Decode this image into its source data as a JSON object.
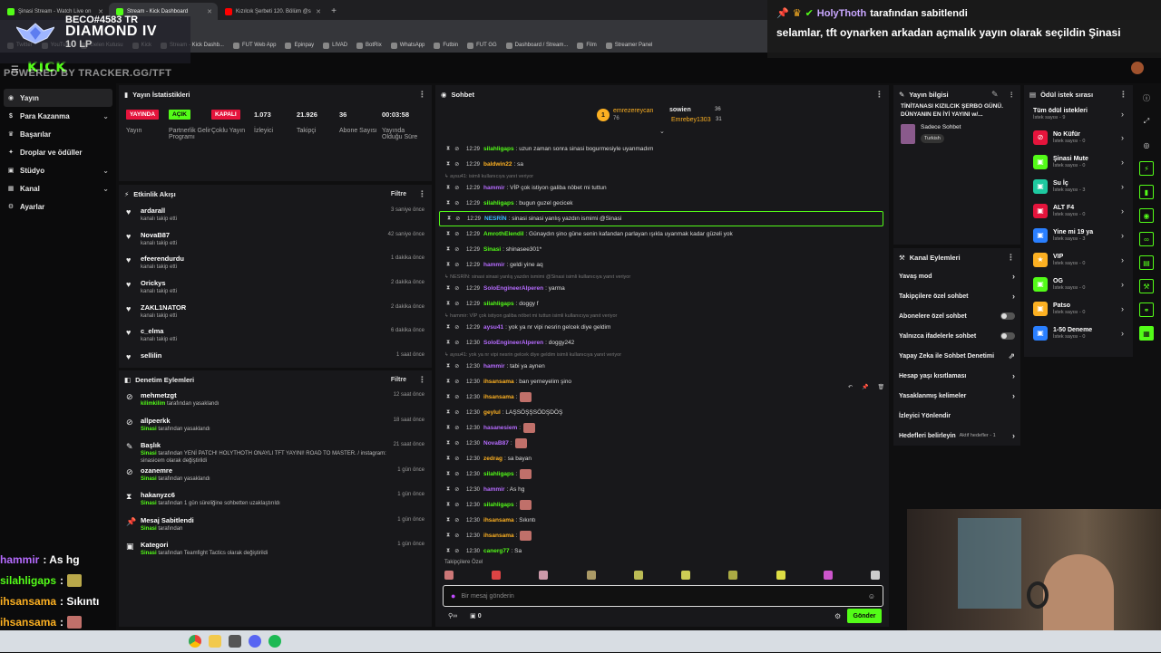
{
  "browser": {
    "tabs": [
      {
        "label": "Şinasi Stream - Watch Live on",
        "color": "#53fc18",
        "active": false
      },
      {
        "label": "Stream - Kick Dashboard",
        "color": "#53fc18",
        "active": true
      },
      {
        "label": "Kızılcık Şerbeti 120. Bölüm @s",
        "color": "#ff0000",
        "active": false
      }
    ],
    "new_tab": "+",
    "bookmarks": [
      "Twitter",
      "YouTube",
      "Gelen Kutusu",
      "Kick",
      "Stream - Kick Dashb...",
      "FUT Web App",
      "Epinpay",
      "LIVAD",
      "BotRix",
      "WhatsApp",
      "Futbin",
      "FUT GG",
      "Dashboard / Stream...",
      "Film",
      "Streamer Panel"
    ]
  },
  "overlay": {
    "rank_tag": "BECO#4583 TR",
    "rank_name": "DIAMOND IV",
    "rank_lp": "10 LP",
    "powered_by": "POWERED BY TRACKER.GG/TFT",
    "pinned_by_user": "HolyThoth",
    "pinned_by_text": "tarafından sabitlendi",
    "pinned_message": "selamlar, tft oynarken arkadan açmalık yayın olarak seçildin Şinasi"
  },
  "kick": {
    "logo": "KICK"
  },
  "sidebar": {
    "items": [
      {
        "label": "Yayın",
        "icon": "broadcast-icon"
      },
      {
        "label": "Para Kazanma",
        "icon": "money-icon"
      },
      {
        "label": "Başarılar",
        "icon": "trophy-icon"
      },
      {
        "label": "Droplar ve ödüller",
        "icon": "gift-icon"
      },
      {
        "label": "Stüdyo",
        "icon": "studio-icon"
      },
      {
        "label": "Kanal",
        "icon": "channel-icon"
      },
      {
        "label": "Ayarlar",
        "icon": "gear-icon"
      }
    ]
  },
  "stream_stats": {
    "title": "Yayın İstatistikleri",
    "items": [
      {
        "value": "YAYINDA",
        "label": "Yayın",
        "pill": "red"
      },
      {
        "value": "AÇIK",
        "label": "Partnerlik Gelir Programı",
        "pill": "green"
      },
      {
        "value": "KAPALI",
        "label": "Çoklu Yayın",
        "pill": "red"
      },
      {
        "value": "1.073",
        "label": "İzleyici",
        "pill": ""
      },
      {
        "value": "21.926",
        "label": "Takipçi",
        "pill": ""
      },
      {
        "value": "36",
        "label": "Abone Sayısı",
        "pill": ""
      },
      {
        "value": "00:03:58",
        "label": "Yayında Olduğu Süre",
        "pill": ""
      }
    ]
  },
  "activity": {
    "title": "Etkinlik Akışı",
    "filter": "Filtre",
    "items": [
      {
        "name": "ardarall",
        "sub": "kanalı takip etti",
        "time": "3 saniye önce"
      },
      {
        "name": "NovaB87",
        "sub": "kanalı takip etti",
        "time": "42 saniye önce"
      },
      {
        "name": "efeerendurdu",
        "sub": "kanalı takip etti",
        "time": "1 dakika önce"
      },
      {
        "name": "Orickys",
        "sub": "kanalı takip etti",
        "time": "2 dakika önce"
      },
      {
        "name": "ZAKL1NATOR",
        "sub": "kanalı takip etti",
        "time": "2 dakika önce"
      },
      {
        "name": "c_elma",
        "sub": "kanalı takip etti",
        "time": "6 dakika önce"
      },
      {
        "name": "sellilin",
        "sub": "",
        "time": "1 saat önce"
      }
    ]
  },
  "moderation": {
    "title": "Denetim Eylemleri",
    "filter": "Filtre",
    "items": [
      {
        "name": "mehmetzgt",
        "actor": "kilimkilim",
        "rest": "tarafından yasaklandı",
        "time": "12 saat önce",
        "icon": "ban-icon"
      },
      {
        "name": "allpeerkk",
        "actor": "Sinasi",
        "rest": "tarafından yasaklandı",
        "time": "18 saat önce",
        "icon": "ban-icon"
      },
      {
        "name": "Başlık",
        "actor": "Sinasi",
        "rest": "tarafından YENİ PATCH! HOLYTHOTH ONAYLI TFT YAYINI! ROAD TO MASTER. / instagram: sinasicem olarak değiştirildi",
        "time": "21 saat önce",
        "icon": "pencil-icon"
      },
      {
        "name": "ozanemre",
        "actor": "Sinasi",
        "rest": "tarafından yasaklandı",
        "time": "1 gün önce",
        "icon": "ban-icon"
      },
      {
        "name": "hakanyzc6",
        "actor": "Sinasi",
        "rest": "tarafından 1 gün süreliğine sohbetten uzaklaştırıldı",
        "time": "1 gün önce",
        "icon": "hourglass-icon"
      },
      {
        "name": "Mesaj Sabitlendi",
        "actor": "Sinasi",
        "rest": "tarafından",
        "time": "1 gün önce",
        "icon": "pin-icon"
      },
      {
        "name": "Kategori",
        "actor": "Sinasi",
        "rest": "tarafından Teamfight Tactics olarak değiştirildi",
        "time": "1 gün önce",
        "icon": "category-icon"
      }
    ]
  },
  "chat": {
    "title": "Sohbet",
    "top_users": [
      {
        "name": "emrezereycan",
        "count": "76",
        "rank": "1"
      },
      {
        "name": "sowien",
        "count": "36"
      },
      {
        "name": "Emrebey1303",
        "count": "31"
      }
    ],
    "messages": [
      {
        "type": "msg",
        "time": "12:29",
        "user": "silahligaps",
        "color": "#53fc18",
        "text": ": uzun zaman sonra sinasi bogurmesiyle uyanmadım"
      },
      {
        "type": "msg",
        "time": "12:29",
        "user": "baldwin22",
        "color": "#fcb022",
        "text": ": sa"
      },
      {
        "type": "reply",
        "text": "aysu41: isimli kullanıcıya yanıt veriyor"
      },
      {
        "type": "msg",
        "time": "12:29",
        "user": "hammir",
        "color": "#b66bff",
        "text": ": VİP çok istiyon galiba nöbet mi tuttun"
      },
      {
        "type": "msg",
        "time": "12:29",
        "user": "silahligaps",
        "color": "#53fc18",
        "text": ": bugun guzel gecicek"
      },
      {
        "type": "msg",
        "time": "12:29",
        "user": "NESRİN",
        "color": "#3db8ff",
        "text": ": sinasi sinasi yanlış yazdın ismimi @Sinasi",
        "highlight": true
      },
      {
        "type": "msg",
        "time": "12:29",
        "user": "AmrothElendil",
        "color": "#53fc18",
        "text": ": Günaydın şino güne senin kafandan parlayan ışıkla uyanmak kadar güzeli yok"
      },
      {
        "type": "msg",
        "time": "12:29",
        "user": "Sinasi",
        "color": "#53fc18",
        "text": ": shinasee301*"
      },
      {
        "type": "msg",
        "time": "12:29",
        "user": "hammir",
        "color": "#b66bff",
        "text": ": geldi yine aq"
      },
      {
        "type": "reply",
        "text": "NESRİN: sinasi sinasi yanlış yazdın ismimi @Sinasi isimli kullanıcıya yanıt veriyor"
      },
      {
        "type": "msg",
        "time": "12:29",
        "user": "SoloEngineerAlperen",
        "color": "#b66bff",
        "text": ": yarma"
      },
      {
        "type": "msg",
        "time": "12:29",
        "user": "silahligaps",
        "color": "#53fc18",
        "text": ": doggy f"
      },
      {
        "type": "reply",
        "text": "hammir: VİP çok istiyon galiba nöbet mi tuttun isimli kullanıcıya yanıt veriyor"
      },
      {
        "type": "msg",
        "time": "12:29",
        "user": "aysu41",
        "color": "#b66bff",
        "text": ": yok ya nr vipi nesrin gelcek diye geldim"
      },
      {
        "type": "msg",
        "time": "12:30",
        "user": "SoloEngineerAlperen",
        "color": "#b66bff",
        "text": ": doggy242"
      },
      {
        "type": "reply",
        "text": "aysu41: yok ya nr vipi nesrin gelcek diye geldim isimli kullanıcıya yanıt veriyor"
      },
      {
        "type": "msg",
        "time": "12:30",
        "user": "hammir",
        "color": "#b66bff",
        "text": ": tabi ya aynen"
      },
      {
        "type": "msg",
        "time": "12:30",
        "user": "ihsansama",
        "color": "#fcb022",
        "text": ": ban yerneyelim şino"
      },
      {
        "type": "msg",
        "time": "12:30",
        "user": "ihsansama",
        "color": "#fcb022",
        "text": ":",
        "emote": true
      },
      {
        "type": "msg",
        "time": "12:30",
        "user": "geylul",
        "color": "#fcb022",
        "text": ": LAŞSÖŞŞSÖDŞDÖŞ"
      },
      {
        "type": "msg",
        "time": "12:30",
        "user": "hasanesiem",
        "color": "#b66bff",
        "text": ":",
        "emote": true
      },
      {
        "type": "msg",
        "time": "12:30",
        "user": "NovaB87",
        "color": "#b66bff",
        "text": ":",
        "emote": true
      },
      {
        "type": "msg",
        "time": "12:30",
        "user": "zedrag",
        "color": "#fcb022",
        "text": ": sa bayan"
      },
      {
        "type": "msg",
        "time": "12:30",
        "user": "silahligaps",
        "color": "#53fc18",
        "text": ":",
        "emote": true
      },
      {
        "type": "msg",
        "time": "12:30",
        "user": "hammir",
        "color": "#b66bff",
        "text": ": As hg"
      },
      {
        "type": "msg",
        "time": "12:30",
        "user": "silahligaps",
        "color": "#53fc18",
        "text": ":",
        "emote": true
      },
      {
        "type": "msg",
        "time": "12:30",
        "user": "ihsansama",
        "color": "#fcb022",
        "text": ": Sıkıntı"
      },
      {
        "type": "msg",
        "time": "12:30",
        "user": "ihsansama",
        "color": "#fcb022",
        "text": ":",
        "emote": true
      },
      {
        "type": "msg",
        "time": "12:30",
        "user": "canerg77",
        "color": "#53fc18",
        "text": ": Sa"
      }
    ],
    "followers_only_label": "Takipçilere Özel",
    "input_placeholder": "Bir mesaj gönderin",
    "points": "0",
    "send_label": "Gönder"
  },
  "stream_info": {
    "title": "Yayın bilgisi",
    "stream_title": "TİNİTANASI KIZILCIK ŞERBO GÜNÜ. DÜNYANIN EN İYİ YAYINI w/...",
    "category": "Sadece Sohbet",
    "tag": "Turkish"
  },
  "channel_actions": {
    "title": "Kanal Eylemleri",
    "items": [
      {
        "label": "Yavaş mod",
        "control": "chevron"
      },
      {
        "label": "Takipçilere özel sohbet",
        "control": "chevron"
      },
      {
        "label": "Abonelere özel sohbet",
        "control": "toggle"
      },
      {
        "label": "Yalnızca ifadelerle sohbet",
        "control": "toggle"
      },
      {
        "label": "Yapay Zeka ile Sohbet Denetimi",
        "control": "external"
      },
      {
        "label": "Hesap yaşı kısıtlaması",
        "control": "chevron"
      },
      {
        "label": "Yasaklanmış kelimeler",
        "control": "chevron"
      },
      {
        "label": "İzleyici Yönlendir",
        "control": ""
      },
      {
        "label": "Hedefleri belirleyin",
        "control": "chevron",
        "extra": "Aktif hedefler - 1"
      }
    ]
  },
  "rewards": {
    "title": "Ödül istek sırası",
    "all_label": "Tüm ödül istekleri",
    "all_sub": "İstek sayısı - 9",
    "items": [
      {
        "name": "No Küfür",
        "sub": "İstek sayısı - 0",
        "color": "#e5143c",
        "icon": "no-icon"
      },
      {
        "name": "Şinasi Mute",
        "sub": "İstek sayısı - 0",
        "color": "#53fc18",
        "icon": "mute-icon"
      },
      {
        "name": "Su İç",
        "sub": "İstek sayısı - 3",
        "color": "#1ec9a0",
        "icon": "water-icon"
      },
      {
        "name": "ALT F4",
        "sub": "İstek sayısı - 0",
        "color": "#e5143c",
        "icon": "power-icon"
      },
      {
        "name": "Yine mi 19 ya",
        "sub": "İstek sayısı - 3",
        "color": "#2a7fff",
        "icon": "dice-icon"
      },
      {
        "name": "VIP",
        "sub": "İstek sayısı - 0",
        "color": "#fcb022",
        "icon": "star-icon"
      },
      {
        "name": "OG",
        "sub": "İstek sayısı - 0",
        "color": "#53fc18",
        "icon": "og-icon"
      },
      {
        "name": "Patso",
        "sub": "İstek sayısı - 0",
        "color": "#fcb022",
        "icon": "gift-icon"
      },
      {
        "name": "1-50 Deneme",
        "sub": "İstek sayısı - 0",
        "color": "#2a7fff",
        "icon": "hash-icon"
      }
    ]
  },
  "stream_chat_overlay": [
    {
      "user": "hammir",
      "color": "#b66bff",
      "text": ": As hg"
    },
    {
      "user": "silahligaps",
      "color": "#53fc18",
      "text": ":"
    },
    {
      "user": "ihsansama",
      "color": "#fcb022",
      "text": ": Sıkıntı"
    },
    {
      "user": "ihsansama",
      "color": "#fcb022",
      "text": ":"
    },
    {
      "user": "canerg77",
      "color": "#53fc18",
      "text": ": Sa"
    }
  ]
}
